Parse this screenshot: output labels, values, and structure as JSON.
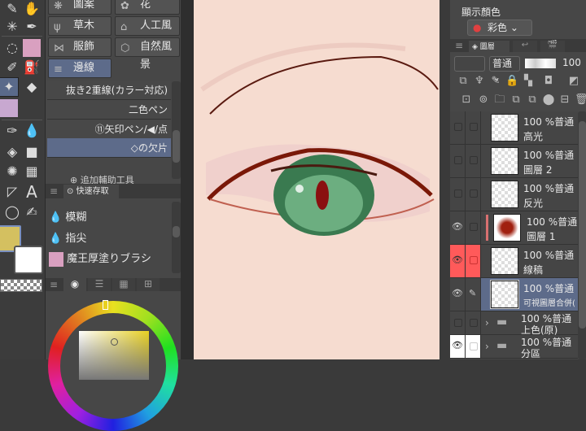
{
  "tools": {
    "icons": [
      "eyedropper-icon",
      "hand-icon",
      "magic-wand-icon",
      "pen-icon",
      "lasso-icon",
      "character-brush-icon",
      "brush-icon",
      "airbrush-icon",
      "sparkle-decoration-icon",
      "eraser-icon",
      "character-icon",
      "blend-icon",
      "dropper-blend-icon",
      "fill-icon",
      "gradient-icon",
      "burst-icon",
      "frame-icon",
      "ruler-icon",
      "text-icon",
      "lasso-select-icon",
      "correction-pen-icon"
    ]
  },
  "colors": {
    "main": "#d4c060",
    "sub": "#ffffff",
    "accent": "#5d6b8a",
    "highlight": "#ff5a5a"
  },
  "sub_tool": {
    "categories": [
      "圖案",
      "花",
      "草木",
      "人工風景",
      "服飾",
      "自然風景",
      "邊線"
    ],
    "brushes": [
      "抜き2重線(カラー対応)",
      "二色ペン",
      "⑪矢印ペン/◀/点",
      "◇の欠片"
    ],
    "add_label": "追加輔助工具"
  },
  "quick_access": {
    "tab": "快速存取",
    "items": [
      "模糊",
      "指尖",
      "魔王厚塗りブラシ"
    ]
  },
  "color_panel": {
    "hue": "yellow"
  },
  "display_color": {
    "label": "顯示顏色",
    "value": "彩色"
  },
  "layers": {
    "tab": "圖層",
    "blend_mode": "普通",
    "opacity": "100",
    "rows": [
      {
        "pct": "100 %普通",
        "name": "高光",
        "visible": false
      },
      {
        "pct": "100 %普通",
        "name": "圖層 2",
        "visible": false
      },
      {
        "pct": "100 %普通",
        "name": "反光",
        "visible": false
      },
      {
        "pct": "100 %普通",
        "name": "圖層 1",
        "visible": true
      },
      {
        "pct": "100 %普通",
        "name": "線稿",
        "visible": true
      },
      {
        "pct": "100 %普通",
        "name": "可視圖層合併(",
        "visible": true
      },
      {
        "pct": "100 %普通",
        "name": "上色(原)",
        "visible": false
      },
      {
        "pct": "100 %普通",
        "name": "分區",
        "visible": true
      }
    ]
  }
}
